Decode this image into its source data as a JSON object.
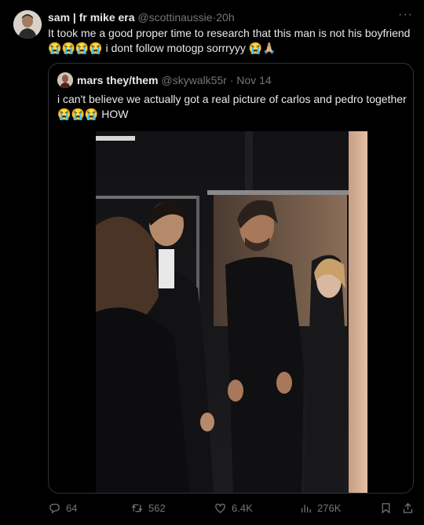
{
  "tweet": {
    "author_name": "sam | fr mike era",
    "author_handle": "@scottinaussie",
    "separator": "·",
    "time": "20h",
    "more_label": "···",
    "text_line1": "It took me a good proper time to research that this man is not his boyfriend",
    "emoji_sob": "😭",
    "text_line2": " i dont follow motogp sorrryyy ",
    "emoji_pray": "🙏🏼"
  },
  "quote": {
    "author_name": "mars they/them",
    "author_handle": "@skywalk55r",
    "separator": "·",
    "date": "Nov 14",
    "text_line1": "i can't believe we actually got a real picture of carlos and pedro together",
    "text_line2": " HOW"
  },
  "actions": {
    "replies": "64",
    "reposts": "562",
    "likes": "6.4K",
    "views": "276K"
  },
  "colors": {
    "background": "#000000",
    "text": "#e7e9ea",
    "secondary": "#71767b",
    "border": "#2f3336"
  }
}
